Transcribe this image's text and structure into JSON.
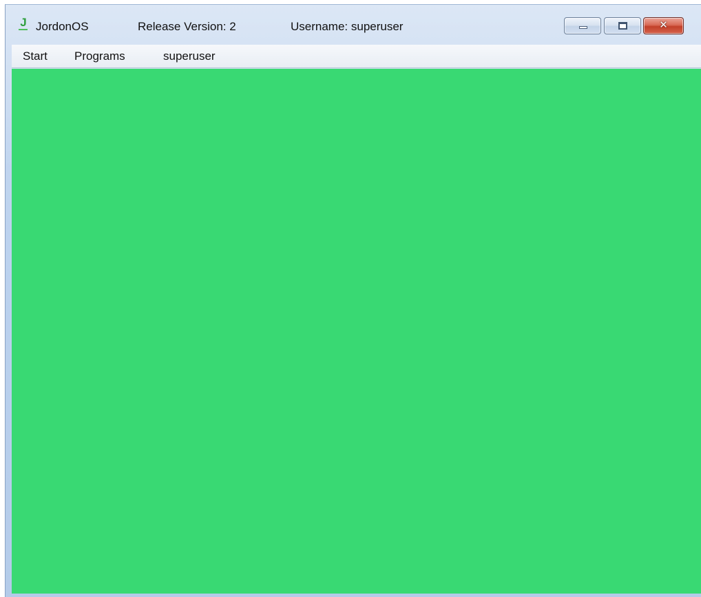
{
  "window": {
    "app_name": "JordonOS",
    "release_version": "Release Version: 2",
    "username": "Username: superuser",
    "icon_letter": "J",
    "icon": "jordonos-app-icon",
    "controls": {
      "minimize_icon": "minimize-icon",
      "maximize_icon": "maximize-icon",
      "close_glyph": "✕",
      "close_icon": "close-icon"
    }
  },
  "menu": {
    "items": [
      {
        "label": "Start"
      },
      {
        "label": "Programs"
      },
      {
        "label": "superuser"
      }
    ]
  },
  "desktop": {
    "background_color": "#39d973"
  },
  "colors": {
    "accent_close": "#c2402a",
    "titlebar": "#bcd2ee",
    "desktop": "#39d973"
  }
}
